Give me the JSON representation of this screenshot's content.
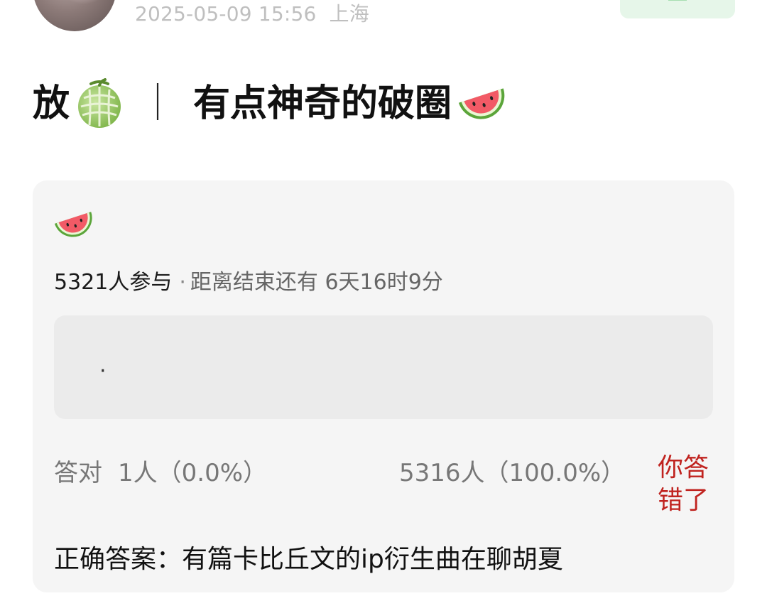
{
  "header": {
    "timestamp": "2025-05-09 15:56",
    "location": "上海",
    "avatar": "user-avatar-photo",
    "follow_icon": "follow-icon",
    "accent_color": "#e6f6e9"
  },
  "post": {
    "title_start": "放",
    "title_sep": "｜",
    "title_main": "有点神奇的破圈",
    "title_icons": [
      "melon-emoji",
      "watermelon-emoji"
    ]
  },
  "quiz": {
    "icon": "watermelon-emoji",
    "participants": "5321人参与",
    "separator": "·",
    "countdown": "距离结束还有 6天16时9分",
    "option_text": "·",
    "correct_label": "答对",
    "correct_count": "1人（0.0%）",
    "wrong_count": "5316人（100.0%）",
    "result": "你答错了",
    "result_color": "#c0231f",
    "answer": "正确答案：有篇卡比丘文的ip衍生曲在聊胡夏"
  }
}
